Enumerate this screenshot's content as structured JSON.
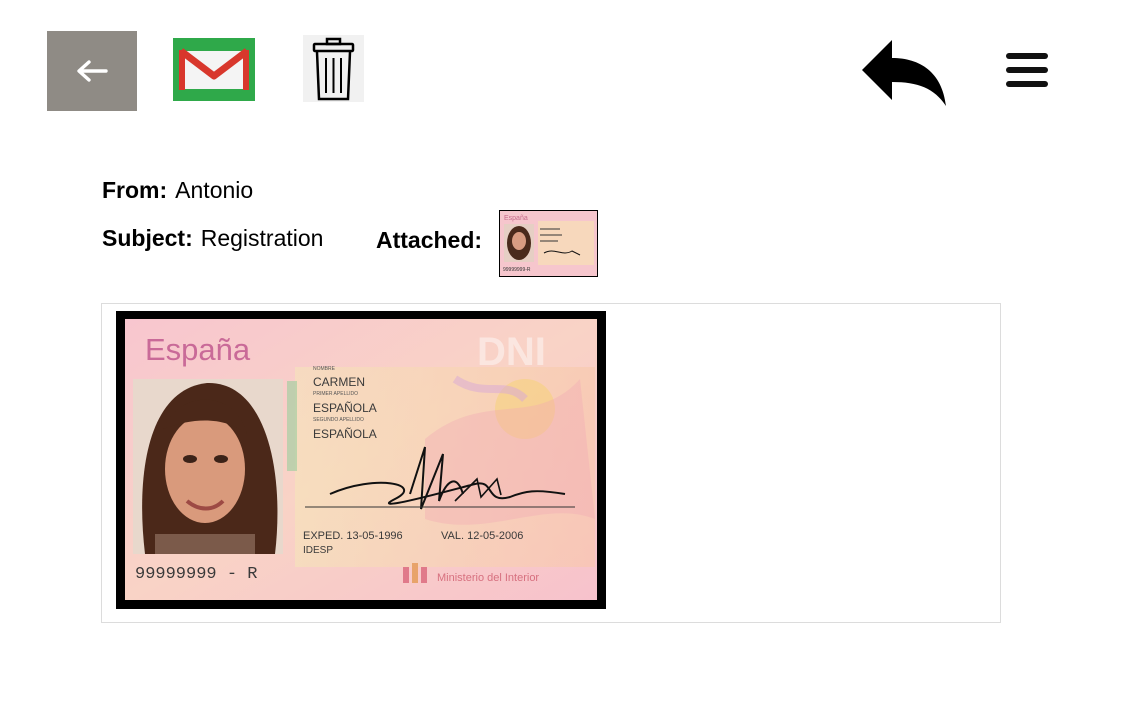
{
  "toolbar": {
    "icons": [
      "back-arrow-icon",
      "gmail-icon",
      "trash-icon",
      "reply-icon",
      "menu-icon"
    ]
  },
  "email": {
    "from_label": "From:",
    "from_value": "Antonio",
    "subject_label": "Subject:",
    "subject_value": "Registration",
    "attached_label": "Attached:"
  },
  "id_card": {
    "country": "España",
    "watermark": "DNI",
    "labels": {
      "name": "NOMBRE",
      "surname1": "PRIMER APELLIDO",
      "surname2": "SEGUNDO APELLIDO"
    },
    "name": "CARMEN",
    "surname1": "ESPAÑOLA",
    "surname2": "ESPAÑOLA",
    "expedition": "EXPED. 13-05-1996",
    "validity": "VAL. 12-05-2006",
    "idesp": "IDESP",
    "number": "99999999 - R",
    "issuer": "Ministerio del Interior"
  },
  "thumbnail": {
    "country": "España",
    "number": "99999999-R"
  },
  "colors": {
    "back_button": "#8f8b85",
    "gmail_green": "#2fa94a",
    "gmail_red": "#d8372c",
    "card_pink": "#f7c8cf"
  }
}
